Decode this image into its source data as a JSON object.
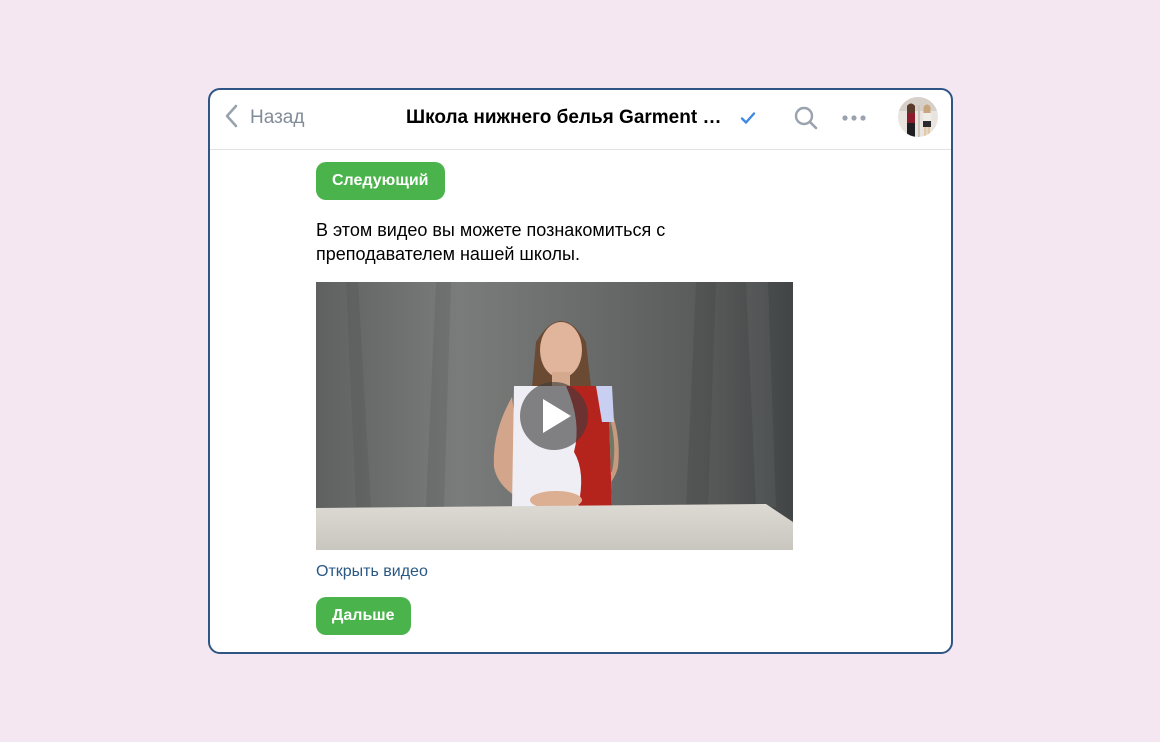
{
  "header": {
    "back_label": "Назад",
    "title": "Школа нижнего белья Garment school",
    "verified": true
  },
  "buttons": {
    "next_label": "Следующий",
    "further_label": "Дальше"
  },
  "message": {
    "text": "В этом видео вы можете познакомиться с преподавателем нашей школы."
  },
  "video": {
    "open_link": "Открыть видео"
  },
  "icons": {
    "back": "chevron-left-icon",
    "verified": "verified-check-icon",
    "search": "search-icon",
    "more": "more-horizontal-icon",
    "play": "play-icon"
  },
  "colors": {
    "background": "#f4e7f2",
    "window_border": "#2e5584",
    "button_green": "#4bb34b",
    "link_blue": "#2a5885",
    "icon_gray": "#99a2ad",
    "verified_blue": "#3f8ae0"
  }
}
